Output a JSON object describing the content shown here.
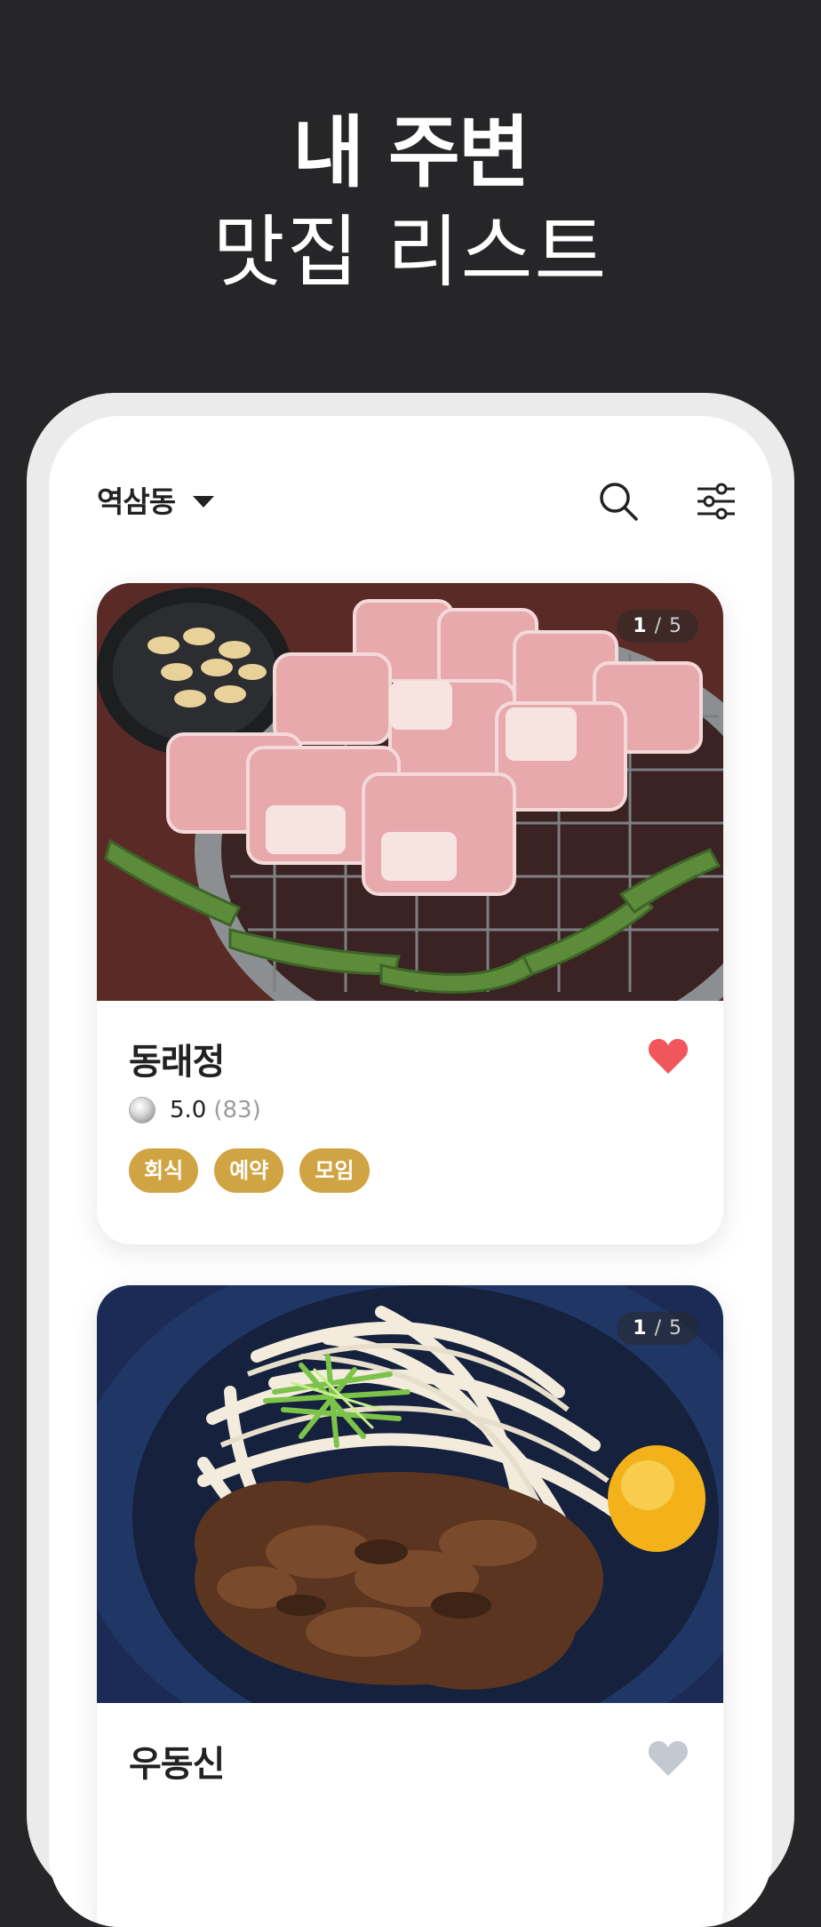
{
  "hero": {
    "line1": "내 주변",
    "line2": "맛집 리스트"
  },
  "header": {
    "location": "역삼동",
    "icons": [
      "caret-down-icon",
      "search-icon",
      "filter-icon"
    ]
  },
  "restaurants": [
    {
      "name": "동래정",
      "rating": "5.0",
      "review_count": "(83)",
      "liked": true,
      "photo_index": "1",
      "photo_total": "/ 5",
      "tags": [
        "회식",
        "예약",
        "모임"
      ]
    },
    {
      "name": "우동신",
      "liked": false,
      "photo_index": "1",
      "photo_total": "/ 5"
    }
  ],
  "colors": {
    "background": "#262628",
    "tag": "#d1a443",
    "heart_liked": "#f0565c",
    "heart_unliked": "#c4c8d0"
  }
}
